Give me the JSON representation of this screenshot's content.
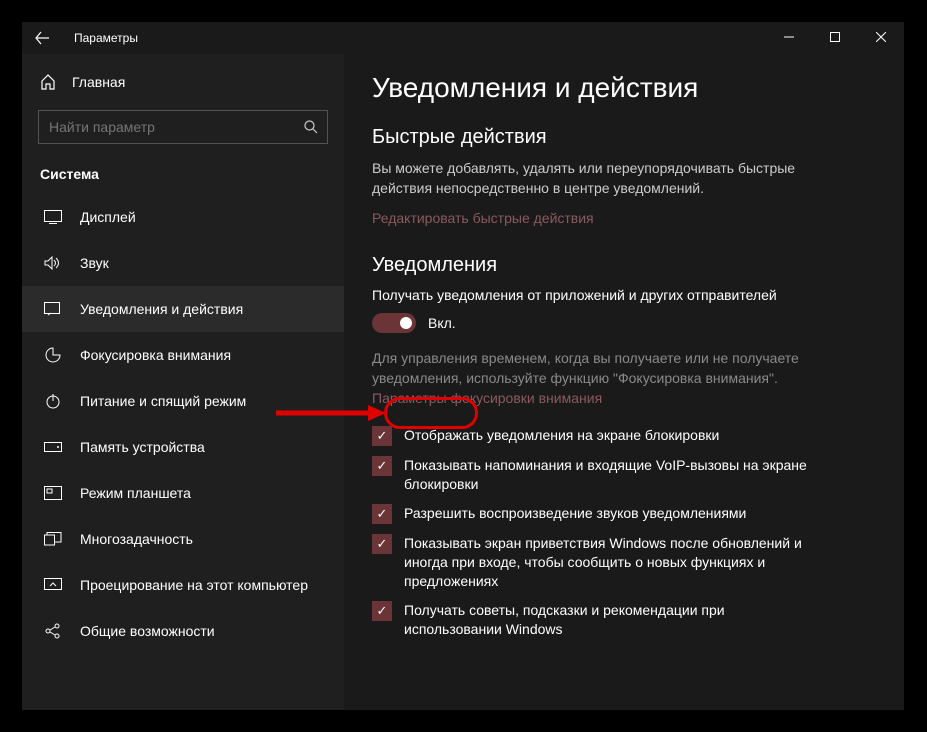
{
  "titlebar": {
    "title": "Параметры"
  },
  "sidebar": {
    "home": "Главная",
    "search_placeholder": "Найти параметр",
    "category": "Система",
    "items": [
      {
        "label": "Дисплей"
      },
      {
        "label": "Звук"
      },
      {
        "label": "Уведомления и действия"
      },
      {
        "label": "Фокусировка внимания"
      },
      {
        "label": "Питание и спящий режим"
      },
      {
        "label": "Память устройства"
      },
      {
        "label": "Режим планшета"
      },
      {
        "label": "Многозадачность"
      },
      {
        "label": "Проецирование на этот компьютер"
      },
      {
        "label": "Общие возможности"
      }
    ]
  },
  "content": {
    "page_title": "Уведомления и действия",
    "quick_actions_heading": "Быстрые действия",
    "quick_actions_desc": "Вы можете добавлять, удалять или переупорядочивать быстрые действия непосредственно в центре уведомлений.",
    "edit_link": "Редактировать быстрые действия",
    "notifications_heading": "Уведомления",
    "toggle_title": "Получать уведомления от приложений и других отправителей",
    "toggle_state": "Вкл.",
    "helper_text": "Для управления временем, когда вы получаете или не получаете уведомления, используйте функцию \"Фокусировка внимания\".",
    "focus_link": "Параметры фокусировки внимания",
    "checks": [
      "Отображать уведомления на экране блокировки",
      "Показывать напоминания и входящие VoIP-вызовы на экране блокировки",
      "Разрешить  воспроизведение звуков уведомлениями",
      "Показывать экран приветствия Windows после обновлений и иногда при входе, чтобы сообщить о новых функциях и предложениях",
      "Получать советы, подсказки и рекомендации при использовании Windows"
    ]
  }
}
